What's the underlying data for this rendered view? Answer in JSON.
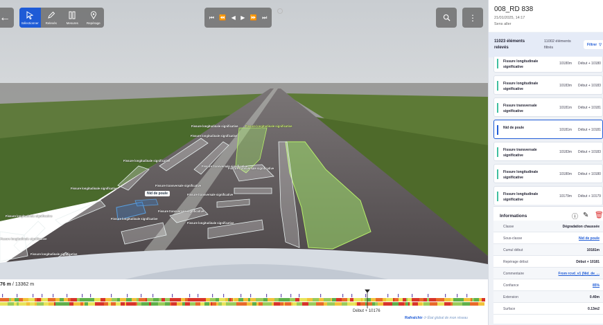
{
  "toolbar": {
    "back_icon": "arrow-left-icon",
    "tools": [
      {
        "label": "Sélectionner",
        "icon": "cursor-icon",
        "active": true
      },
      {
        "label": "Relevés",
        "icon": "pencil-icon",
        "active": false
      },
      {
        "label": "Mesures",
        "icon": "ruler-icon",
        "active": false
      },
      {
        "label": "Repérage",
        "icon": "pin-icon",
        "active": false
      }
    ]
  },
  "player": {
    "buttons": [
      {
        "name": "first",
        "glyph": "⏮"
      },
      {
        "name": "rewind",
        "glyph": "⏪"
      },
      {
        "name": "prev",
        "glyph": "◀"
      },
      {
        "name": "play",
        "glyph": "▶"
      },
      {
        "name": "fast-forward",
        "glyph": "⏩"
      },
      {
        "name": "last",
        "glyph": "⏭"
      }
    ]
  },
  "scene_labels": [
    "Fissure longitudinale significative",
    "Fissure longitudinale significative",
    "Fissure longitudinale significative",
    "Fissure longitudinale significative",
    "Fissure transversale significative",
    "Fissure transversale significative",
    "Fissure longitudinale significative",
    "Fissure transversale significative",
    "Nid de poule",
    "Fissure longitudinale significative",
    "Fissure longitudinale significative",
    "Fissure transversale significative",
    "Fissure longitudinale significative",
    "Fissure transversale significative",
    "Fissure longitudinale significative",
    "Fissure longitudinale significative"
  ],
  "timeline": {
    "position": "76 m",
    "total": "13362 m",
    "separator": " / ",
    "debut_label": "Début + 10176",
    "refresh": "Rafraîchir",
    "global": "État global de mon réseau"
  },
  "panel": {
    "title": "008_RD 838",
    "date": "21/01/2025, 14:17",
    "direction": "Sens aller",
    "count_total": "11023 éléments relevés",
    "count_filtered": "11002 éléments filtrés",
    "filter_label": "Filtrer",
    "items": [
      {
        "name": "Fissure longitudinale significative",
        "cumul": "10180m",
        "repere": "Début + 10180",
        "selected": false
      },
      {
        "name": "Fissure longitudinale significative",
        "cumul": "10183m",
        "repere": "Début + 10183",
        "selected": false
      },
      {
        "name": "Fissure transversale significative",
        "cumul": "10181m",
        "repere": "Début + 10181",
        "selected": false
      },
      {
        "name": "Nid de poule",
        "cumul": "10181m",
        "repere": "Début + 10181",
        "selected": true
      },
      {
        "name": "Fissure transversale significative",
        "cumul": "10183m",
        "repere": "Début + 10183",
        "selected": false
      },
      {
        "name": "Fissure longitudinale significative",
        "cumul": "10180m",
        "repere": "Début + 10180",
        "selected": false
      },
      {
        "name": "Fissure longitudinale significative",
        "cumul": "10179m",
        "repere": "Début + 10179",
        "selected": false
      }
    ],
    "info": {
      "title": "Informations",
      "rows": [
        {
          "key": "Classe",
          "value": "Dégradation chaussée",
          "link": false
        },
        {
          "key": "Sous-classe",
          "value": "Nid de poule",
          "link": true
        },
        {
          "key": "Cumul début",
          "value": "10181m",
          "link": false
        },
        {
          "key": "Repérage début",
          "value": "Début + 10181",
          "link": false
        },
        {
          "key": "Commentaire",
          "value": "From rcvd_v1 (Nid_de_...",
          "link": true
        },
        {
          "key": "Confiance",
          "value": "85%",
          "link": true
        },
        {
          "key": "Extension",
          "value": "0.40m",
          "link": false
        },
        {
          "key": "Surface",
          "value": "0.13m2",
          "link": false
        }
      ]
    }
  },
  "colors": {
    "accent": "#1e5bd6",
    "detection_fill": "#9fe06a",
    "sky": "#cfd3d6"
  }
}
